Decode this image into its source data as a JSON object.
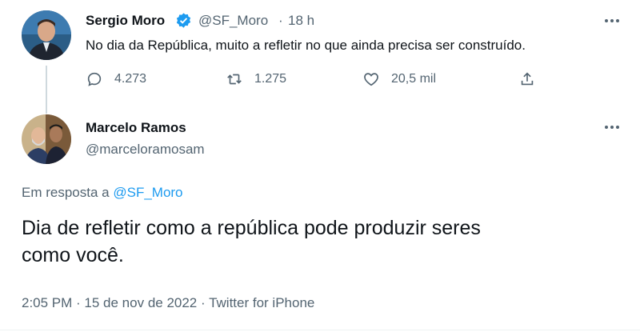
{
  "tweet": {
    "author_name": "Sergio Moro",
    "handle": "@SF_Moro",
    "separator": "·",
    "time_ago": "18 h",
    "text": "No dia da República, muito a refletir no que ainda precisa ser construído.",
    "replies": "4.273",
    "retweets": "1.275",
    "likes": "20,5 mil"
  },
  "reply": {
    "author_name": "Marcelo Ramos",
    "handle": "@marceloramosam",
    "replying_to_prefix": "Em resposta a",
    "replying_to_handle": "@SF_Moro",
    "text_line1": "Dia de refletir como a república pode produzir seres",
    "text_line2": "como você.",
    "meta": "2:05 PM · 15 de nov de 2022 · Twitter for iPhone"
  },
  "icons": {
    "verified": "verified-badge-icon",
    "reply": "reply-icon",
    "retweet": "retweet-icon",
    "like": "heart-icon",
    "share": "share-icon",
    "more": "more-icon"
  },
  "colors": {
    "accent": "#1d9bf0",
    "text": "#0f1419",
    "muted": "#536471"
  }
}
